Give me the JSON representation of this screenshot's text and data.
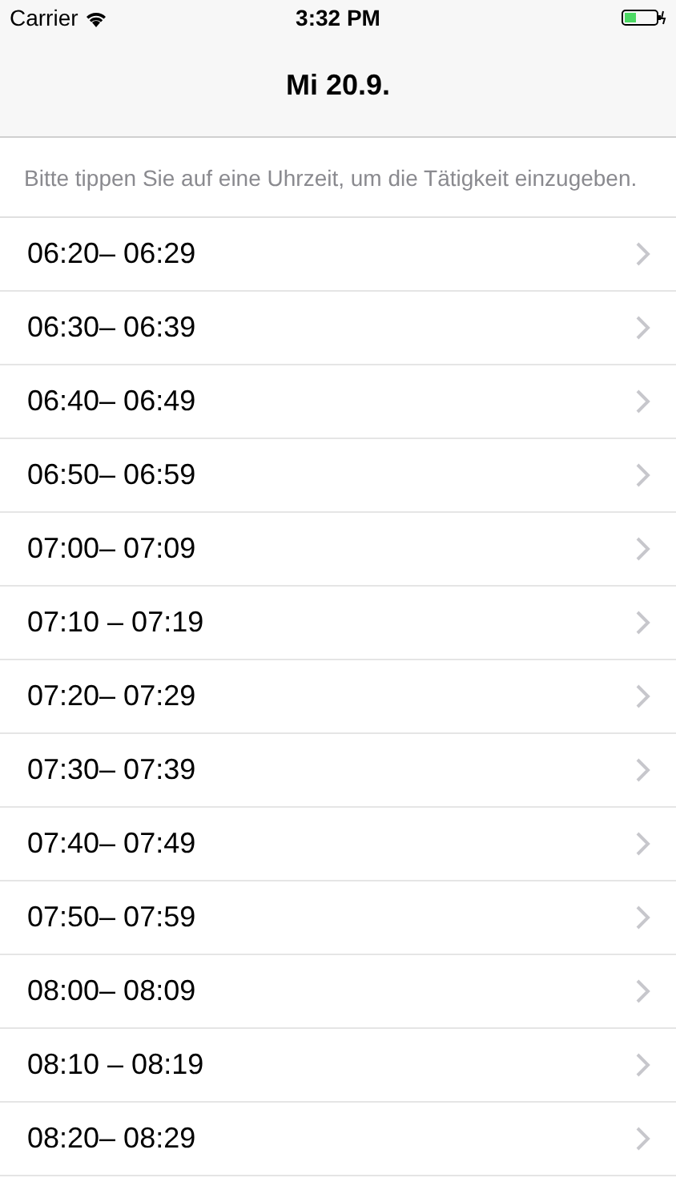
{
  "status_bar": {
    "carrier": "Carrier",
    "time": "3:32 PM"
  },
  "nav": {
    "title": "Mi 20.9."
  },
  "hint": "Bitte tippen Sie auf eine Uhrzeit, um die Tätigkeit einzugeben.",
  "slots": [
    {
      "label": "06:20– 06:29"
    },
    {
      "label": "06:30– 06:39"
    },
    {
      "label": "06:40– 06:49"
    },
    {
      "label": "06:50– 06:59"
    },
    {
      "label": "07:00– 07:09"
    },
    {
      "label": "07:10 – 07:19"
    },
    {
      "label": "07:20– 07:29"
    },
    {
      "label": "07:30– 07:39"
    },
    {
      "label": "07:40– 07:49"
    },
    {
      "label": "07:50– 07:59"
    },
    {
      "label": "08:00– 08:09"
    },
    {
      "label": "08:10 – 08:19"
    },
    {
      "label": "08:20– 08:29"
    }
  ]
}
